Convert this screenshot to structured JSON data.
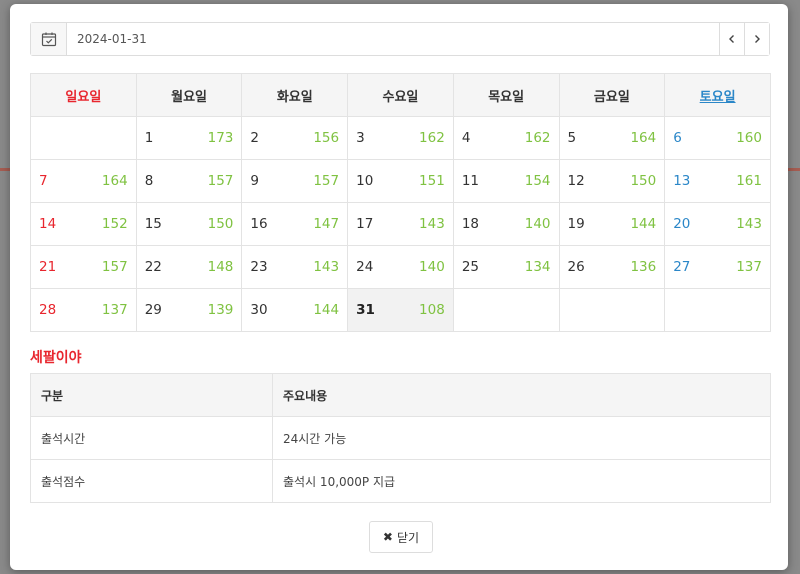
{
  "date_bar": {
    "date_value": "2024-01-31",
    "prev_icon": "chevron-left-icon",
    "next_icon": "chevron-right-icon",
    "calendar_icon": "calendar-check-icon"
  },
  "calendar": {
    "weekdays": [
      "일요일",
      "월요일",
      "화요일",
      "수요일",
      "목요일",
      "금요일",
      "토요일"
    ],
    "weeks": [
      [
        {
          "day": "",
          "count": ""
        },
        {
          "day": "1",
          "count": "173"
        },
        {
          "day": "2",
          "count": "156"
        },
        {
          "day": "3",
          "count": "162"
        },
        {
          "day": "4",
          "count": "162"
        },
        {
          "day": "5",
          "count": "164"
        },
        {
          "day": "6",
          "count": "160"
        }
      ],
      [
        {
          "day": "7",
          "count": "164"
        },
        {
          "day": "8",
          "count": "157"
        },
        {
          "day": "9",
          "count": "157"
        },
        {
          "day": "10",
          "count": "151"
        },
        {
          "day": "11",
          "count": "154"
        },
        {
          "day": "12",
          "count": "150"
        },
        {
          "day": "13",
          "count": "161"
        }
      ],
      [
        {
          "day": "14",
          "count": "152"
        },
        {
          "day": "15",
          "count": "150"
        },
        {
          "day": "16",
          "count": "147"
        },
        {
          "day": "17",
          "count": "143"
        },
        {
          "day": "18",
          "count": "140"
        },
        {
          "day": "19",
          "count": "144"
        },
        {
          "day": "20",
          "count": "143"
        }
      ],
      [
        {
          "day": "21",
          "count": "157"
        },
        {
          "day": "22",
          "count": "148"
        },
        {
          "day": "23",
          "count": "143"
        },
        {
          "day": "24",
          "count": "140"
        },
        {
          "day": "25",
          "count": "134"
        },
        {
          "day": "26",
          "count": "136"
        },
        {
          "day": "27",
          "count": "137"
        }
      ],
      [
        {
          "day": "28",
          "count": "137"
        },
        {
          "day": "29",
          "count": "139"
        },
        {
          "day": "30",
          "count": "144"
        },
        {
          "day": "31",
          "count": "108"
        },
        {
          "day": "",
          "count": ""
        },
        {
          "day": "",
          "count": ""
        },
        {
          "day": "",
          "count": ""
        }
      ]
    ],
    "today": "31",
    "colors": {
      "sunday": "#e8262e",
      "saturday": "#2b87c8",
      "count": "#7fc241"
    }
  },
  "section_title": "세팔이야",
  "info_table": {
    "headers": [
      "구분",
      "주요내용"
    ],
    "rows": [
      [
        "출석시간",
        "24시간 가능"
      ],
      [
        "출석점수",
        "출석시 10,000P 지급"
      ]
    ]
  },
  "close_button": {
    "label": "닫기",
    "icon": "close-icon"
  }
}
